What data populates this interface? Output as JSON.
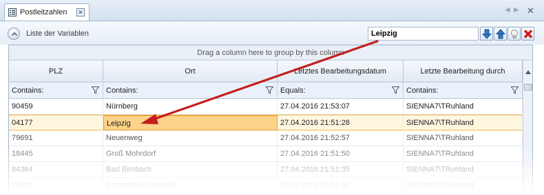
{
  "tab": {
    "label": "Postleitzahlen",
    "close_label": "✕"
  },
  "window": {
    "nav_prev": "◀",
    "nav_next": "▶",
    "close": "✕"
  },
  "toolbar": {
    "title": "Liste der Variablen",
    "search_value": "Leipzig"
  },
  "grid": {
    "group_panel_text": "Drag a column here to group by this column",
    "columns": [
      {
        "header": "PLZ",
        "filter": "Contains:"
      },
      {
        "header": "Ort",
        "filter": "Contains:"
      },
      {
        "header": "Letztes Bearbeitungsdatum",
        "filter": "Equals:"
      },
      {
        "header": "Letzte Bearbeitung durch",
        "filter": "Contains:"
      }
    ],
    "rows": [
      {
        "plz": "90459",
        "ort": "Nürnberg",
        "datum": "27.04.2016 21:53:07",
        "user": "SIENNA7\\TRuhland"
      },
      {
        "plz": "04177",
        "ort": "Leipzig",
        "datum": "27.04.2016 21:51:28",
        "user": "SIENNA7\\TRuhland"
      },
      {
        "plz": "79691",
        "ort": "Neuenweg",
        "datum": "27.04.2016 21:52:57",
        "user": "SIENNA7\\TRuhland"
      },
      {
        "plz": "18445",
        "ort": "Groß Mohrdorf",
        "datum": "27.04.2016 21:51:50",
        "user": "SIENNA7\\TRuhland"
      },
      {
        "plz": "84364",
        "ort": "Bad Birnbach",
        "datum": "27.04.2016 21:51:35",
        "user": "SIENNA7\\TRuhland"
      },
      {
        "plz": "25924",
        "ort": "Emmelsbüll-Horsbüll",
        "datum": "27.04.2016 21:51:42",
        "user": "SIENNA7\\TRuhland"
      }
    ]
  },
  "colors": {
    "accent_arrow": "#b3161b",
    "selection": "#fcd38a",
    "header_bg": "#e2eaf4"
  }
}
